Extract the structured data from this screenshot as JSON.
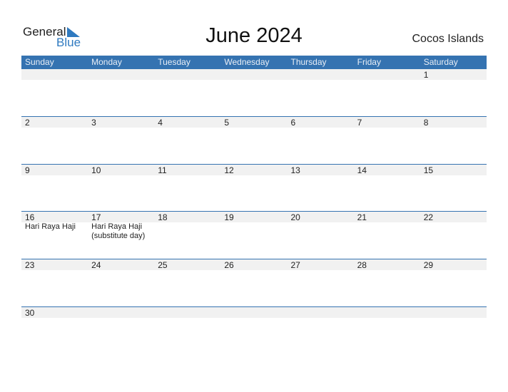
{
  "logo": {
    "word1": "General",
    "word2": "Blue"
  },
  "title": "June 2024",
  "country": "Cocos Islands",
  "colors": {
    "accent": "#3573b1",
    "row_bg": "#f1f1f1"
  },
  "weekdays": [
    "Sunday",
    "Monday",
    "Tuesday",
    "Wednesday",
    "Thursday",
    "Friday",
    "Saturday"
  ],
  "weeks": [
    {
      "days": [
        "",
        "",
        "",
        "",
        "",
        "",
        "1"
      ],
      "holidays": [
        "",
        "",
        "",
        "",
        "",
        "",
        ""
      ]
    },
    {
      "days": [
        "2",
        "3",
        "4",
        "5",
        "6",
        "7",
        "8"
      ],
      "holidays": [
        "",
        "",
        "",
        "",
        "",
        "",
        ""
      ]
    },
    {
      "days": [
        "9",
        "10",
        "11",
        "12",
        "13",
        "14",
        "15"
      ],
      "holidays": [
        "",
        "",
        "",
        "",
        "",
        "",
        ""
      ]
    },
    {
      "days": [
        "16",
        "17",
        "18",
        "19",
        "20",
        "21",
        "22"
      ],
      "holidays": [
        "Hari Raya Haji",
        "Hari Raya Haji (substitute day)",
        "",
        "",
        "",
        "",
        ""
      ]
    },
    {
      "days": [
        "23",
        "24",
        "25",
        "26",
        "27",
        "28",
        "29"
      ],
      "holidays": [
        "",
        "",
        "",
        "",
        "",
        "",
        ""
      ]
    },
    {
      "days": [
        "30",
        "",
        "",
        "",
        "",
        "",
        ""
      ],
      "holidays": [
        "",
        "",
        "",
        "",
        "",
        "",
        ""
      ]
    }
  ]
}
